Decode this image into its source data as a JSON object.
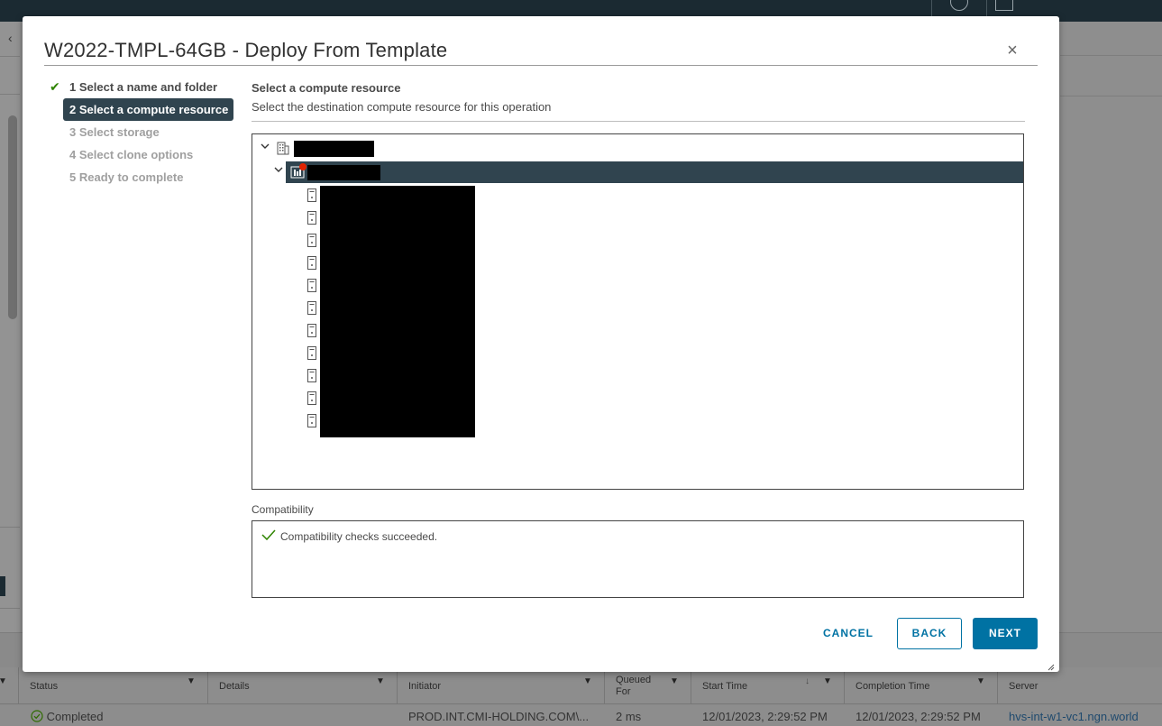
{
  "modal": {
    "title": "W2022-TMPL-64GB - Deploy From Template",
    "close_icon": "close-icon",
    "steps": [
      {
        "label": "1 Select a name and folder",
        "state": "completed"
      },
      {
        "label": "2 Select a compute resource",
        "state": "active"
      },
      {
        "label": "3 Select storage",
        "state": "pending"
      },
      {
        "label": "4 Select clone options",
        "state": "pending"
      },
      {
        "label": "5 Ready to complete",
        "state": "pending"
      }
    ],
    "section_title": "Select a compute resource",
    "section_description": "Select the destination compute resource for this operation",
    "tree": {
      "datacenter": {
        "name": "",
        "icon": "datacenter-icon",
        "expanded": true
      },
      "cluster": {
        "name": "",
        "icon": "cluster-icon",
        "expanded": true,
        "selected": true,
        "has_alert": true
      },
      "hosts": [
        {
          "name": "",
          "icon": "host-icon"
        },
        {
          "name": "",
          "icon": "host-icon"
        },
        {
          "name": "",
          "icon": "host-icon"
        },
        {
          "name": "",
          "icon": "host-icon"
        },
        {
          "name": "",
          "icon": "host-icon"
        },
        {
          "name": "",
          "icon": "host-icon"
        },
        {
          "name": "",
          "icon": "host-icon"
        },
        {
          "name": "",
          "icon": "host-icon"
        },
        {
          "name": "",
          "icon": "host-icon"
        },
        {
          "name": "",
          "icon": "host-icon"
        },
        {
          "name": "",
          "icon": "host-icon"
        }
      ]
    },
    "compatibility": {
      "label": "Compatibility",
      "message": "Compatibility checks succeeded."
    },
    "buttons": {
      "cancel": "CANCEL",
      "back": "BACK",
      "next": "NEXT"
    }
  },
  "tasks_table": {
    "columns": [
      "Status",
      "Details",
      "Initiator",
      "Queued For",
      "Start Time",
      "Completion Time",
      "Server"
    ],
    "queued_line1": "Queued",
    "queued_line2": "For",
    "row": {
      "status": "Completed",
      "details": "",
      "initiator": "PROD.INT.CMI-HOLDING.COM\\...",
      "queued_for": "2 ms",
      "start_time": "12/01/2023, 2:29:52 PM",
      "completion_time": "12/01/2023, 2:29:52 PM",
      "server": "hvs-int-w1-vc1.ngn.world"
    }
  },
  "colors": {
    "accent": "#0072a3",
    "selected_row": "#30444f",
    "success": "#2f8400",
    "alert": "#e12200"
  }
}
